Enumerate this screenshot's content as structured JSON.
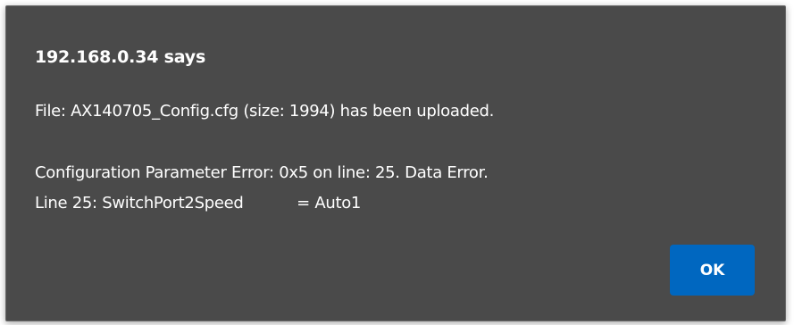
{
  "dialog": {
    "title": "192.168.0.34 says",
    "lines": [
      "File: AX140705_Config.cfg (size: 1994) has been uploaded.",
      "Configuration Parameter Error: 0x5 on line: 25. Data Error.",
      "Line 25: SwitchPort2Speed           = Auto1"
    ],
    "ok_label": "OK"
  },
  "colors": {
    "dialog_background": "#4a4a4a",
    "button_background": "#0067c0",
    "text": "#ffffff"
  }
}
